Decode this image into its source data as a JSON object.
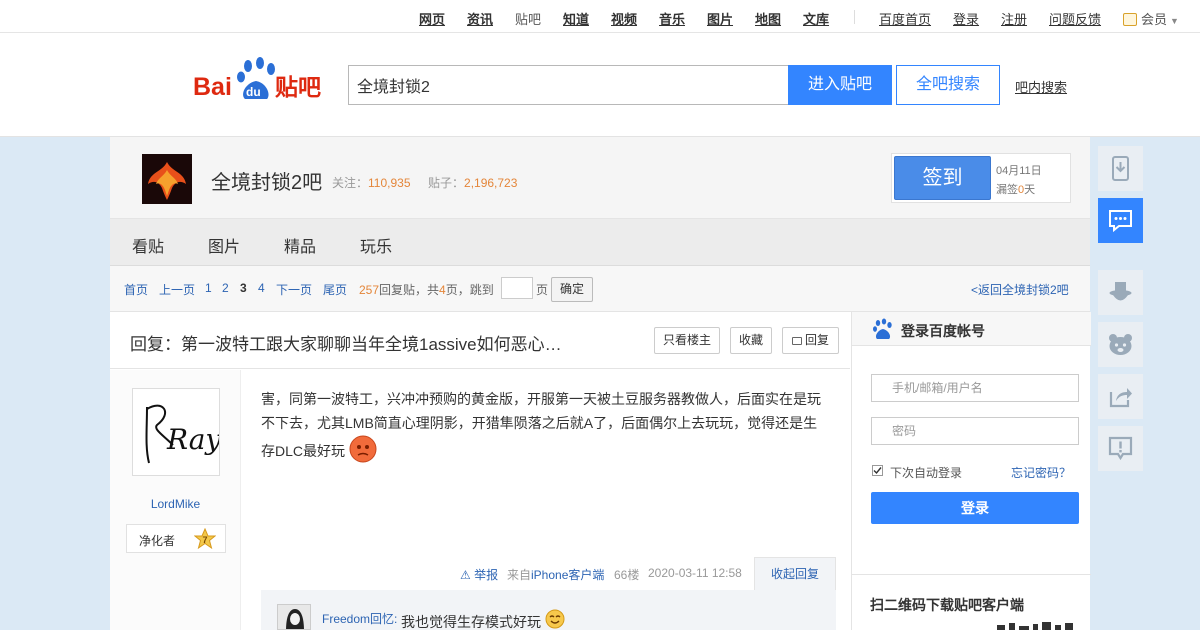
{
  "topbar": {
    "nav": [
      "网页",
      "资讯",
      "贴吧",
      "知道",
      "视频",
      "音乐",
      "图片",
      "地图",
      "文库"
    ],
    "links": [
      "百度首页",
      "登录",
      "注册",
      "问题反馈"
    ],
    "member": "会员"
  },
  "header": {
    "logo_text": "Bai贴吧",
    "search_value": "全境封锁2",
    "enter_button": "进入贴吧",
    "all_search_button": "全吧搜索",
    "inbar_search": "吧内搜索"
  },
  "forum": {
    "name": "全境封锁2吧",
    "follow_label": "关注：",
    "follow_count": "110,935",
    "post_label": "贴子：",
    "post_count": "2,196,723",
    "sign_button": "签到",
    "sign_date": "04月11日",
    "miss_label": "漏签",
    "miss_days": "0",
    "miss_unit": "天"
  },
  "tabs": [
    "看贴",
    "图片",
    "精品",
    "玩乐"
  ],
  "pager": {
    "first": "首页",
    "prev": "上一页",
    "pages": [
      "1",
      "2",
      "3",
      "4"
    ],
    "current": "3",
    "next": "下一页",
    "last": "尾页",
    "reply_count": "257",
    "reply_text": "回复贴，共",
    "page_total": "4",
    "page_text": "页，跳到",
    "page_unit": "页",
    "confirm": "确定",
    "back": "<返回全境封锁2吧"
  },
  "thread": {
    "title": "回复：第一波特工跟大家聊聊当年全境1assive如何恶心…",
    "only_owner": "只看楼主",
    "collect": "收藏",
    "reply": "回复"
  },
  "post": {
    "username": "LordMike",
    "badge_name": "净化者",
    "badge_level": "7",
    "content": "害，同第一波特工，兴冲冲预购的黄金版，开服第一天被土豆服务器教做人，后面实在是玩不下去，尤其LMB简直心理阴影，开猎隼陨落之后就A了，后面偶尔上去玩玩，觉得还是生存DLC最好玩",
    "report": "举报",
    "from_label": "来自",
    "client": "iPhone客户端",
    "floor": "66楼",
    "time": "2020-03-11 12:58",
    "collapse": "收起回复",
    "avatar_text": "Ray"
  },
  "reply": {
    "user": "Freedom回忆:",
    "text": "我也觉得生存模式好玩"
  },
  "login": {
    "title": "登录百度帐号",
    "user_placeholder": "手机/邮箱/用户名",
    "pwd_placeholder": "密码",
    "auto_login": "下次自动登录",
    "forget": "忘记密码？",
    "button": "登录",
    "qr_title": "扫二维码下载贴吧客户端"
  },
  "colors": {
    "brand_blue": "#3385ff",
    "link_blue": "#2d64b3",
    "orange": "#e4863a",
    "logo_red": "#de2910"
  }
}
